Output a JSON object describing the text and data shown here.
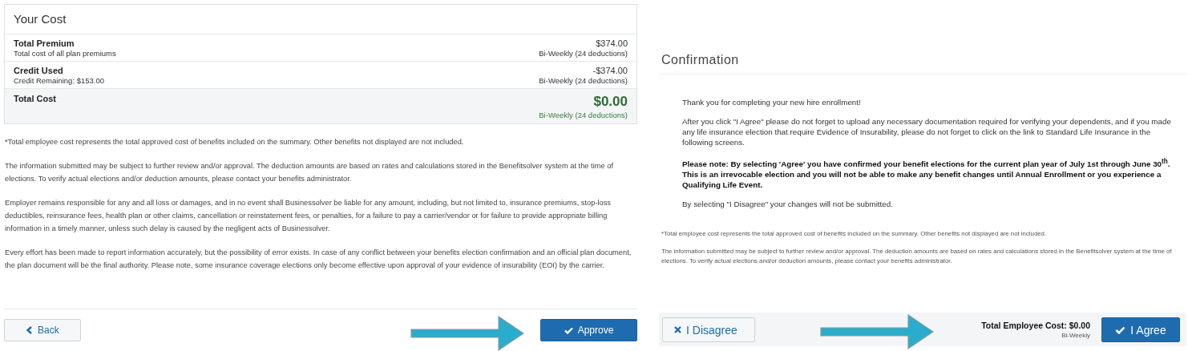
{
  "cost_summary": {
    "title": "Your Cost",
    "rows": [
      {
        "kind": "line",
        "label": "Total Premium",
        "sublabel": "Total cost of all plan premiums",
        "amount": "$374.00",
        "frequency": "Bi-Weekly (24 deductions)"
      },
      {
        "kind": "line",
        "label": "Credit Used",
        "sublabel": "Credit Remaining: $153.00",
        "amount": "-$374.00",
        "frequency": "Bi-Weekly (24 deductions)"
      },
      {
        "kind": "total",
        "label": "Total Cost",
        "amount": "$0.00",
        "frequency": "Bi-Weekly (24 deductions)"
      }
    ],
    "notes": [
      "*Total employee cost represents the total approved cost of benefits included on the summary. Other benefits not displayed are not included.",
      "The information submitted may be subject to further review and/or approval. The deduction amounts are based on rates and calculations stored in the Benefitsolver system at the time of elections. To verify actual elections and/or deduction amounts, please contact your benefits administrator.",
      "Employer remains responsible for any and all loss or damages, and in no event shall Businessolver be liable for any amount, including, but not limited to, insurance premiums, stop-loss deductibles, reinsurance fees, health plan or other claims, cancellation or reinstatement fees, or penalties, for a failure to pay a carrier/vendor or for failure to provide appropriate billing information in a timely manner, unless such delay is caused by the negligent acts of Businessolver.",
      "Every effort has been made to report information accurately, but the possibility of error exists. In case of any conflict between your benefits election confirmation and an official plan document, the plan document will be the final authority. Please note, some insurance coverage elections only become effective upon approval of your evidence of insurability (EOI) by the carrier."
    ],
    "back_button": "Back",
    "approve_button": "Approve"
  },
  "confirmation": {
    "title": "Confirmation",
    "paragraphs": [
      {
        "kind": "plain",
        "text": "Thank you for completing your new hire enrollment!"
      },
      {
        "kind": "plain",
        "text": "After you click \"I Agree\" please do not forget to upload any necessary documentation required for verifying your dependents, and if you made any life insurance election that require Evidence of Insurability, please do not forget to click on the link to Standard Life Insurance in the following screens."
      },
      {
        "kind": "bold",
        "text": "Please note: By selecting 'Agree' you have confirmed your benefit elections for the current plan year of July 1st through June 30$^{th}$.  This is an irrevocable election and you will not be able to make any benefit changes until Annual Enrollment or you experience a Qualifying Life Event."
      },
      {
        "kind": "plain",
        "text": "By selecting \"I Disagree\" your changes will not be submitted."
      }
    ],
    "notes": [
      "*Total employee cost represents the total approved cost of benefits included on the summary. Other benefits not displayed are not included.",
      "The information submitted may be subject to further review and/or approval. The deduction amounts are based on rates and calculations stored in the Benefitsolver system at the time of elections. To verify actual elections and/or deduction amounts, please contact your benefits administrator."
    ],
    "disagree_button": "I Disagree",
    "total_label": "Total Employee Cost: $0.00",
    "total_frequency": "Bi-Weekly",
    "agree_button": "I Agree"
  }
}
